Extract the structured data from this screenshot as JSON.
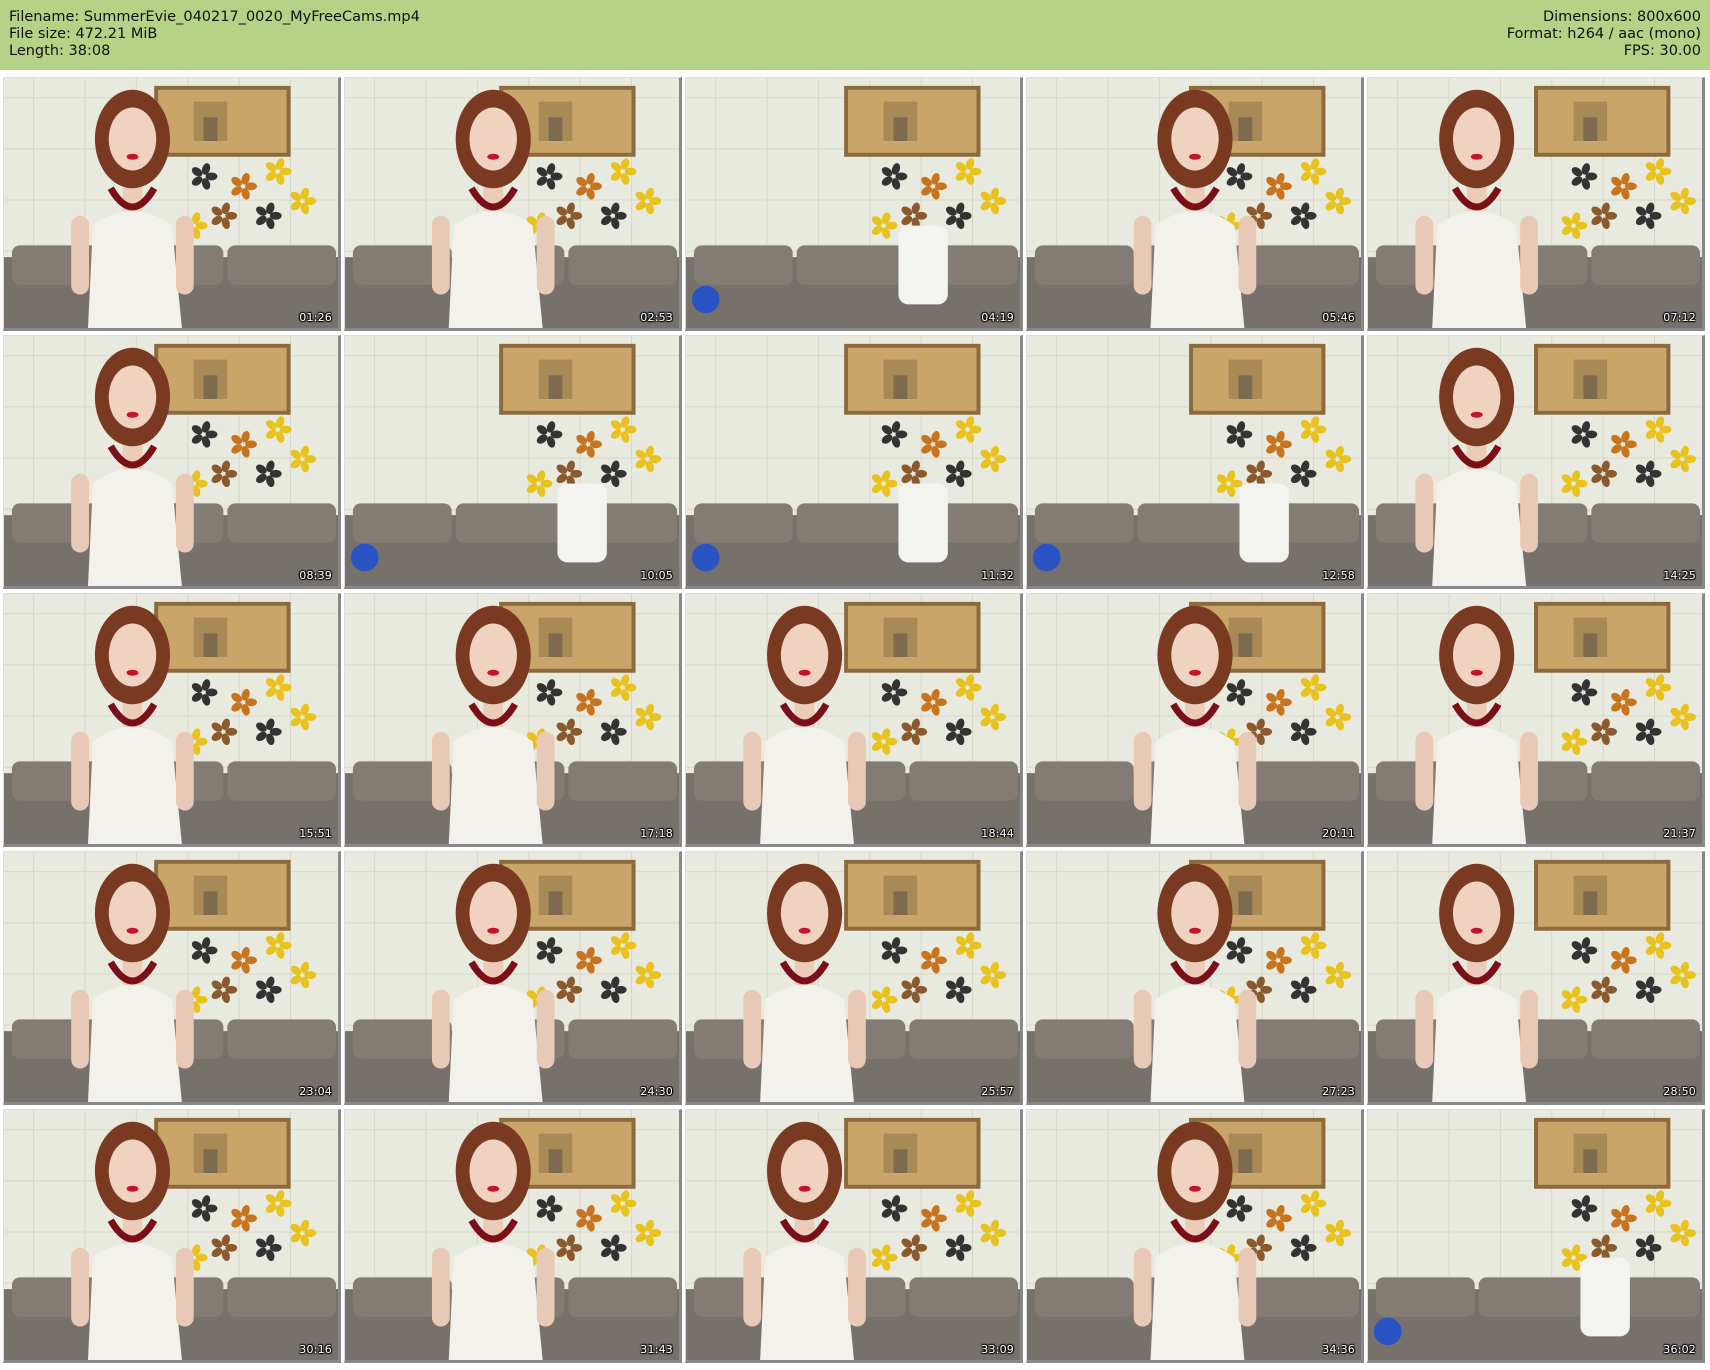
{
  "header": {
    "filename": "Filename: SummerEvie_040217_0020_MyFreeCams.mp4",
    "filesize": "File size: 472.21 MiB",
    "length": "Length: 38:08",
    "dimensions": "Dimensions: 800x600",
    "format": "Format: h264 / aac (mono)",
    "fps": "FPS: 30.00"
  },
  "colors": {
    "header_bg": "#b5d287",
    "wall": "#e9eadf",
    "sofa": "#77716b",
    "painting": "#c9a56a",
    "top": "#f2f1ec",
    "hair": "#7a3a22",
    "necklace": "#7b0f17"
  },
  "thumbnails": [
    {
      "time": "01:26",
      "person": true
    },
    {
      "time": "02:53",
      "person": true
    },
    {
      "time": "04:19",
      "person": false
    },
    {
      "time": "05:46",
      "person": true
    },
    {
      "time": "07:12",
      "person": true
    },
    {
      "time": "08:39",
      "person": true
    },
    {
      "time": "10:05",
      "person": false
    },
    {
      "time": "11:32",
      "person": false
    },
    {
      "time": "12:58",
      "person": false
    },
    {
      "time": "14:25",
      "person": true
    },
    {
      "time": "15:51",
      "person": true
    },
    {
      "time": "17:18",
      "person": true
    },
    {
      "time": "18:44",
      "person": true
    },
    {
      "time": "20:11",
      "person": true
    },
    {
      "time": "21:37",
      "person": true
    },
    {
      "time": "23:04",
      "person": true
    },
    {
      "time": "24:30",
      "person": true
    },
    {
      "time": "25:57",
      "person": true
    },
    {
      "time": "27:23",
      "person": true
    },
    {
      "time": "28:50",
      "person": true
    },
    {
      "time": "30:16",
      "person": true
    },
    {
      "time": "31:43",
      "person": true
    },
    {
      "time": "33:09",
      "person": true
    },
    {
      "time": "34:36",
      "person": true
    },
    {
      "time": "36:02",
      "person": false
    }
  ]
}
